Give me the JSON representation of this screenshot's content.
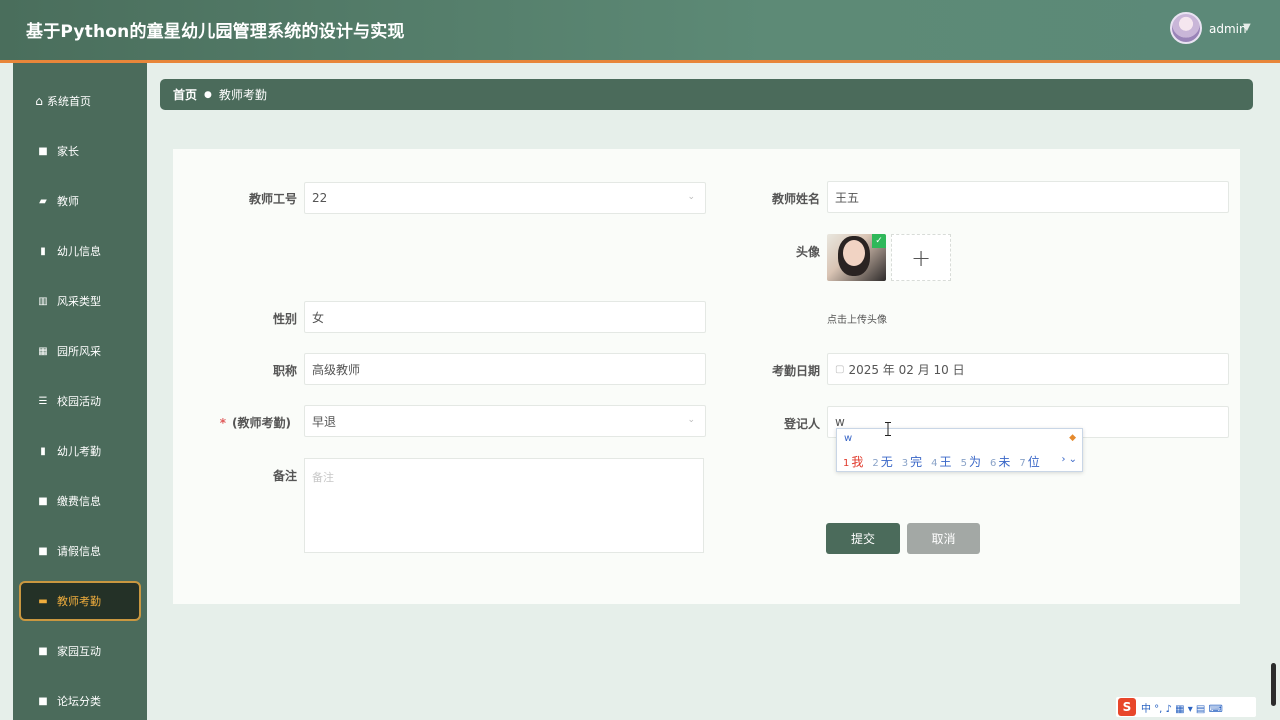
{
  "header": {
    "title": "基于Python的童星幼儿园管理系统的设计与实现",
    "user": "admin",
    "caret": "▼"
  },
  "sidebar": {
    "items": [
      {
        "label": "系统首页",
        "icon": "home-icon",
        "glyph": "⌂"
      },
      {
        "label": "家长",
        "icon": "grid-icon",
        "glyph": "■"
      },
      {
        "label": "教师",
        "icon": "thumbs-up-icon",
        "glyph": "▰"
      },
      {
        "label": "幼儿信息",
        "icon": "clipboard-icon",
        "glyph": "▮"
      },
      {
        "label": "风采类型",
        "icon": "bar-chart-icon",
        "glyph": "▥"
      },
      {
        "label": "园所风采",
        "icon": "table-icon",
        "glyph": "▦"
      },
      {
        "label": "校园活动",
        "icon": "list-icon",
        "glyph": "☰"
      },
      {
        "label": "幼儿考勤",
        "icon": "book-icon",
        "glyph": "▮"
      },
      {
        "label": "缴费信息",
        "icon": "grid-icon",
        "glyph": "■"
      },
      {
        "label": "请假信息",
        "icon": "grid-icon",
        "glyph": "■"
      },
      {
        "label": "教师考勤",
        "icon": "cup-icon",
        "glyph": "▬"
      },
      {
        "label": "家园互动",
        "icon": "grid-icon",
        "glyph": "■"
      },
      {
        "label": "论坛分类",
        "icon": "grid-icon",
        "glyph": "■"
      }
    ],
    "active_index": 10
  },
  "breadcrumb": {
    "home": "首页",
    "separator": "●",
    "current": "教师考勤"
  },
  "form": {
    "teacher_id": {
      "label": "教师工号",
      "value": "22"
    },
    "teacher_name": {
      "label": "教师姓名",
      "value": "王五"
    },
    "avatar": {
      "label": "头像",
      "hint": "点击上传头像",
      "plus": "+"
    },
    "gender": {
      "label": "性别",
      "value": "女"
    },
    "title": {
      "label": "职称",
      "value": "高级教师"
    },
    "date": {
      "label": "考勤日期",
      "value": "2025 年 02 月 10 日"
    },
    "attendance": {
      "required_mark": "*",
      "label": "(教师考勤)",
      "value": "早退"
    },
    "registrar": {
      "label": "登记人",
      "value": "w"
    },
    "remark": {
      "label": "备注",
      "placeholder": "备注"
    },
    "submit": "提交",
    "cancel": "取消"
  },
  "ime": {
    "typed": "w",
    "candidates": [
      {
        "n": "1",
        "text": "我"
      },
      {
        "n": "2",
        "text": "无"
      },
      {
        "n": "3",
        "text": "完"
      },
      {
        "n": "4",
        "text": "王"
      },
      {
        "n": "5",
        "text": "为"
      },
      {
        "n": "6",
        "text": "未"
      },
      {
        "n": "7",
        "text": "位"
      }
    ],
    "nav": "› ⌄"
  },
  "tray": {
    "logo": "S",
    "icons": "中 °, ♪ ▦ ▾ ▤ ⌨"
  }
}
